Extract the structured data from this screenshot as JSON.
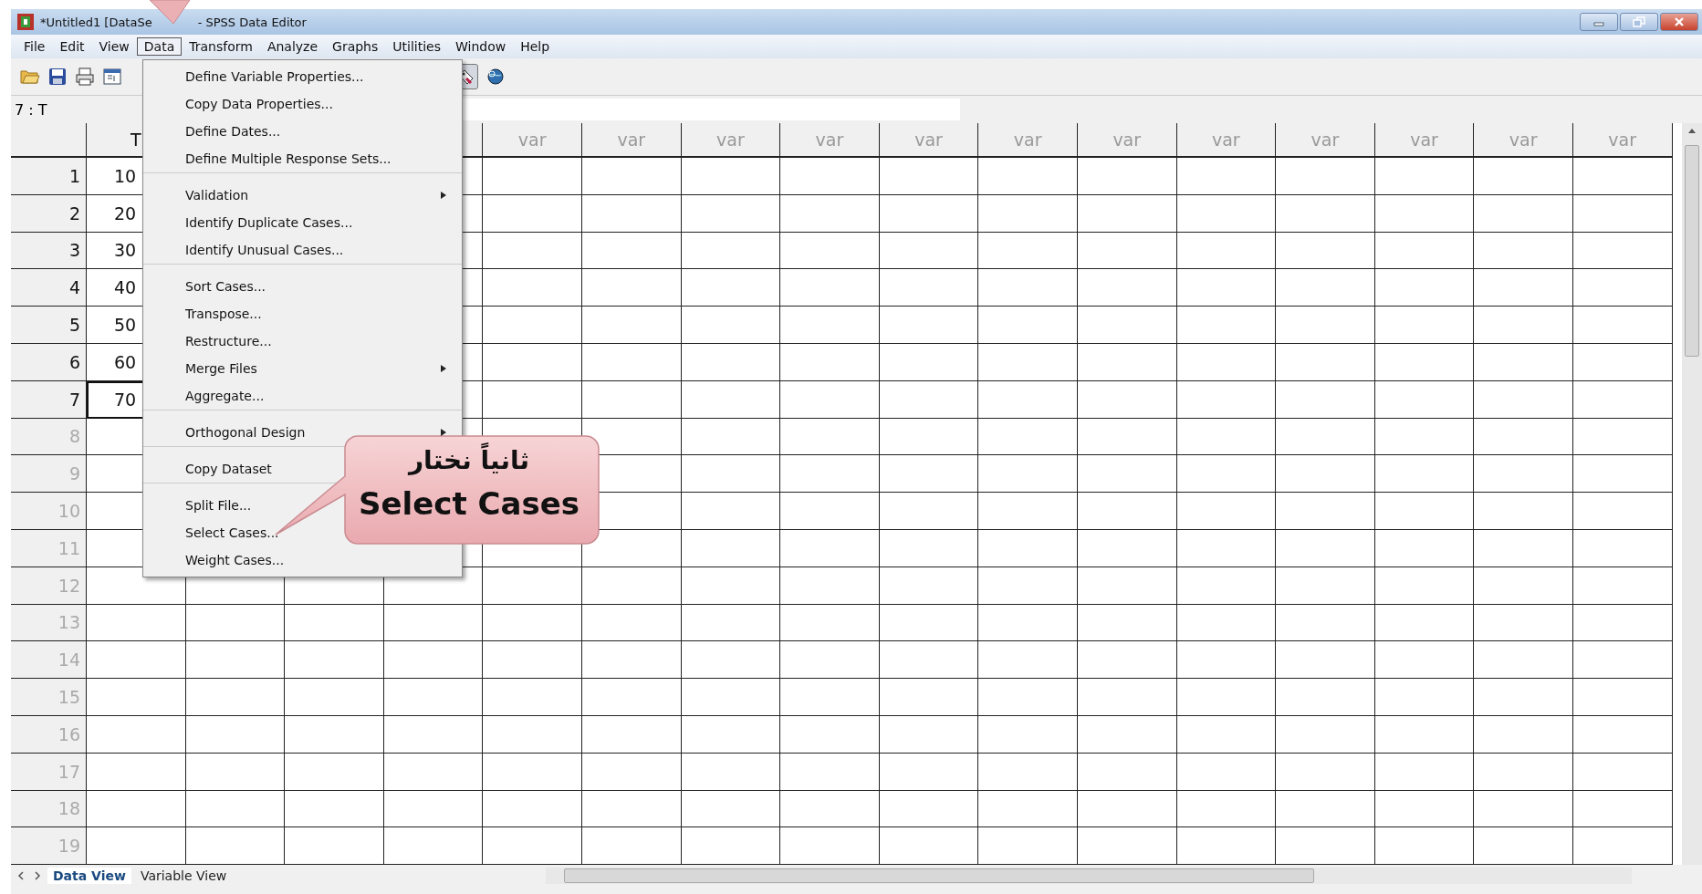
{
  "window": {
    "title_parts": [
      "*Untitled1 [DataSe",
      "- SPSS Data Editor"
    ]
  },
  "menu_bar": [
    {
      "label": "File",
      "selected": false
    },
    {
      "label": "Edit",
      "selected": false
    },
    {
      "label": "View",
      "selected": false
    },
    {
      "label": "Data",
      "selected": true
    },
    {
      "label": "Transform",
      "selected": false
    },
    {
      "label": "Analyze",
      "selected": false
    },
    {
      "label": "Graphs",
      "selected": false
    },
    {
      "label": "Utilities",
      "selected": false
    },
    {
      "label": "Window",
      "selected": false
    },
    {
      "label": "Help",
      "selected": false
    }
  ],
  "toolbar": {
    "value_labels_on": true
  },
  "cell_ref": {
    "value": "7 : T"
  },
  "grid": {
    "columns": [
      {
        "label": "T"
      },
      {},
      {},
      {},
      {
        "label": "var"
      },
      {
        "label": "var"
      },
      {
        "label": "var"
      },
      {
        "label": "var"
      },
      {
        "label": "var"
      },
      {
        "label": "var"
      },
      {
        "label": "var"
      },
      {
        "label": "var"
      },
      {
        "label": "var"
      },
      {
        "label": "var"
      },
      {
        "label": "var"
      },
      {
        "label": "var"
      }
    ],
    "rows": [
      {
        "number": "1",
        "has_data": true,
        "value": "10",
        "selected": false
      },
      {
        "number": "2",
        "has_data": true,
        "value": "20",
        "selected": false
      },
      {
        "number": "3",
        "has_data": true,
        "value": "30",
        "selected": false
      },
      {
        "number": "4",
        "has_data": true,
        "value": "40",
        "selected": false
      },
      {
        "number": "5",
        "has_data": true,
        "value": "50",
        "selected": false
      },
      {
        "number": "6",
        "has_data": true,
        "value": "60",
        "selected": false
      },
      {
        "number": "7",
        "has_data": true,
        "value": "70",
        "selected": true
      },
      {
        "number": "8",
        "has_data": false
      },
      {
        "number": "9",
        "has_data": false
      },
      {
        "number": "10",
        "has_data": false
      },
      {
        "number": "11",
        "has_data": false
      },
      {
        "number": "12",
        "has_data": false
      },
      {
        "number": "13",
        "has_data": false
      },
      {
        "number": "14",
        "has_data": false
      },
      {
        "number": "15",
        "has_data": false
      },
      {
        "number": "16",
        "has_data": false
      },
      {
        "number": "17",
        "has_data": false
      },
      {
        "number": "18",
        "has_data": false
      },
      {
        "number": "19",
        "has_data": false
      }
    ]
  },
  "data_menu": {
    "items": [
      {
        "label": "Define Variable Properties...",
        "submenu": false,
        "separator_after": false
      },
      {
        "label": "Copy Data Properties...",
        "submenu": false,
        "separator_after": false
      },
      {
        "label": "Define Dates...",
        "submenu": false,
        "separator_after": false
      },
      {
        "label": "Define Multiple Response Sets...",
        "submenu": false,
        "separator_after": true
      },
      {
        "label": "Validation",
        "submenu": true,
        "separator_after": false
      },
      {
        "label": "Identify Duplicate Cases...",
        "submenu": false,
        "separator_after": false
      },
      {
        "label": "Identify Unusual Cases...",
        "submenu": false,
        "separator_after": true
      },
      {
        "label": "Sort Cases...",
        "submenu": false,
        "separator_after": false
      },
      {
        "label": "Transpose...",
        "submenu": false,
        "separator_after": false
      },
      {
        "label": "Restructure...",
        "submenu": false,
        "separator_after": false
      },
      {
        "label": "Merge Files",
        "submenu": true,
        "separator_after": false
      },
      {
        "label": "Aggregate...",
        "submenu": false,
        "separator_after": true
      },
      {
        "label": "Orthogonal Design",
        "submenu": true,
        "separator_after": true
      },
      {
        "label": "Copy Dataset",
        "submenu": false,
        "separator_after": true
      },
      {
        "label": "Split File...",
        "submenu": false,
        "separator_after": false
      },
      {
        "label": "Select Cases...",
        "submenu": false,
        "separator_after": false
      },
      {
        "label": "Weight Cases...",
        "submenu": false,
        "separator_after": false
      }
    ]
  },
  "callout": {
    "lines": [
      "ثانياً نختار",
      "Select Cases"
    ]
  },
  "tabs": [
    {
      "label": "Data View",
      "selected": true
    },
    {
      "label": "Variable View",
      "selected": false
    }
  ]
}
